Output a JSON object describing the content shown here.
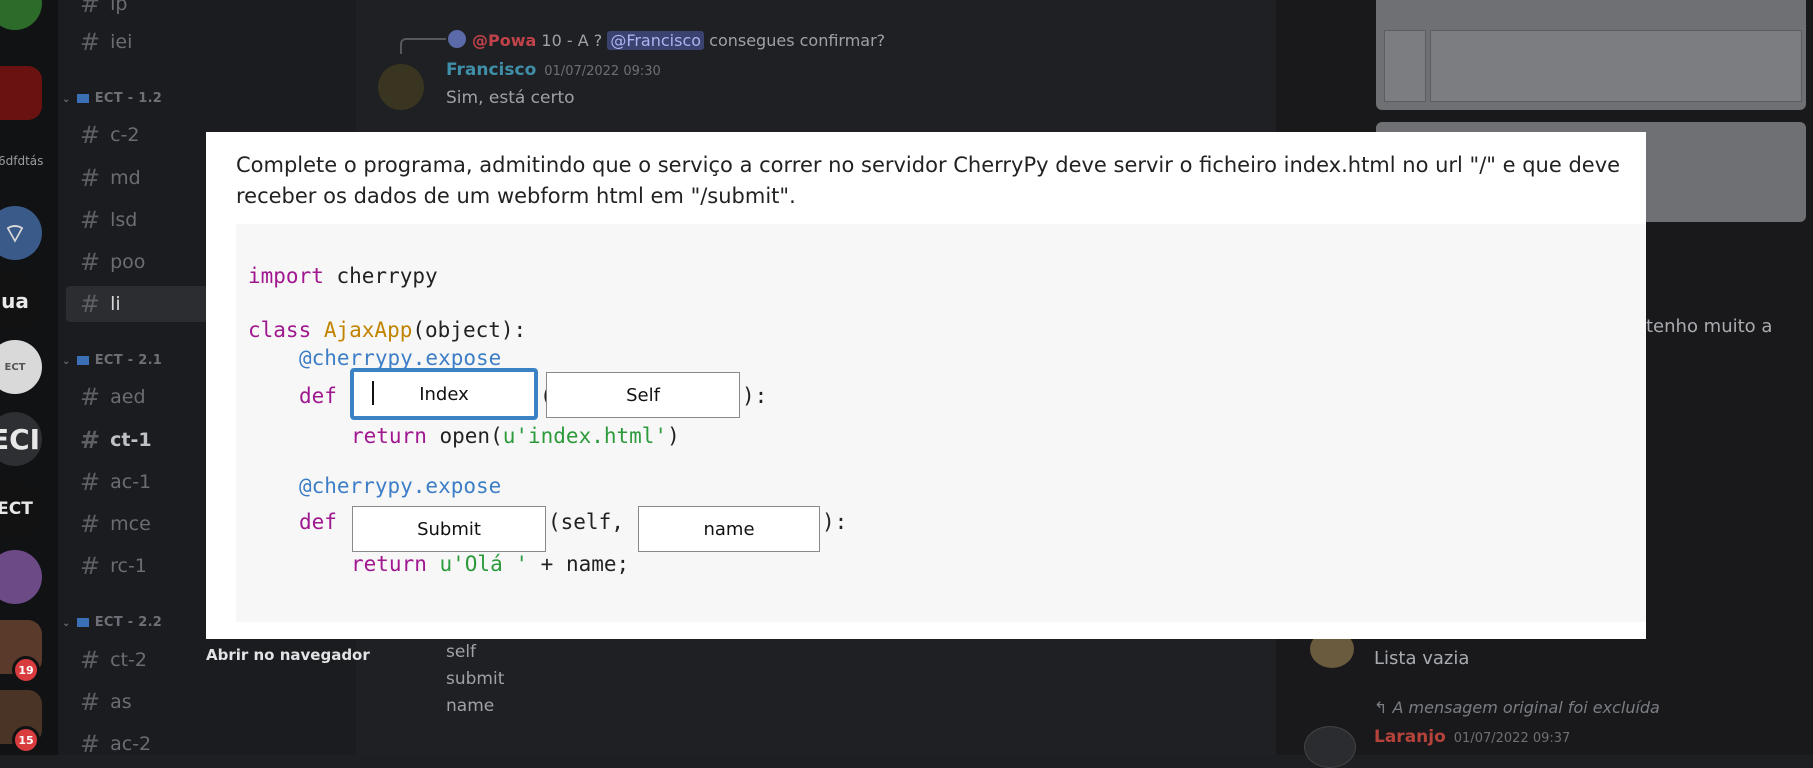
{
  "sidebar": {
    "guild_label": "6dfdtás",
    "guild_short": [
      "ua",
      "ECT",
      "ECI",
      "ECT"
    ],
    "badges": [
      "19",
      "15"
    ],
    "categories": [
      "ECT - 1.2",
      "ECT - 2.1",
      "ECT - 2.2"
    ],
    "channels_top": [
      "lp",
      "iei"
    ],
    "channels_cat1": [
      "c-2",
      "md",
      "lsd",
      "poo",
      "li"
    ],
    "channels_cat2": [
      "aed",
      "ct-1",
      "ac-1",
      "mce",
      "rc-1"
    ],
    "channels_cat3": [
      "ct-2",
      "as",
      "ac-2"
    ]
  },
  "chat": {
    "reply_author": "@Powa",
    "reply_text": "10 - A ?",
    "reply_mention": "@Francisco",
    "reply_tail": "consegues confirmar?",
    "author": "Francisco",
    "timestamp": "01/07/2022 09:30",
    "message": "Sim, está certo",
    "answers": [
      "self",
      "submit",
      "name"
    ]
  },
  "right": {
    "partial_text": "tenho muito a",
    "empty_list": "Lista vazia",
    "deleted_note": "A mensagem original foi excluída",
    "author2": "Laranjo",
    "timestamp2": "01/07/2022 09:37"
  },
  "modal": {
    "prompt": "Complete o programa, admitindo que o serviço a correr no servidor CherryPy deve servir o ficheiro index.html no url \"/\" e que deve receber os dados de um webform html em \"/submit\".",
    "code": {
      "import_kw": "import",
      "import_mod": " cherrypy",
      "class_kw": "class",
      "class_name": " AjaxApp",
      "class_rest": "(object):",
      "decorator": "@cherrypy.expose",
      "def_kw": "def",
      "paren_open": "(",
      "paren_close": "):",
      "return_kw": "return",
      "return1_mid": " open(",
      "return1_str": "u'index.html'",
      "return1_end": ")",
      "def2_mid": "(self,",
      "return2_str": " u'Olá '",
      "return2_end": " + name;"
    },
    "blanks": {
      "index": "Index",
      "self": "Self",
      "submit": "Submit",
      "name": "name"
    }
  },
  "footer": {
    "open_browser": "Abrir no navegador"
  },
  "colors": {
    "focus_border": "#3b82c4",
    "keyword": "#a0188f",
    "class_name": "#c18401",
    "decorator": "#3d7ec6",
    "string": "#2d9b3c"
  }
}
